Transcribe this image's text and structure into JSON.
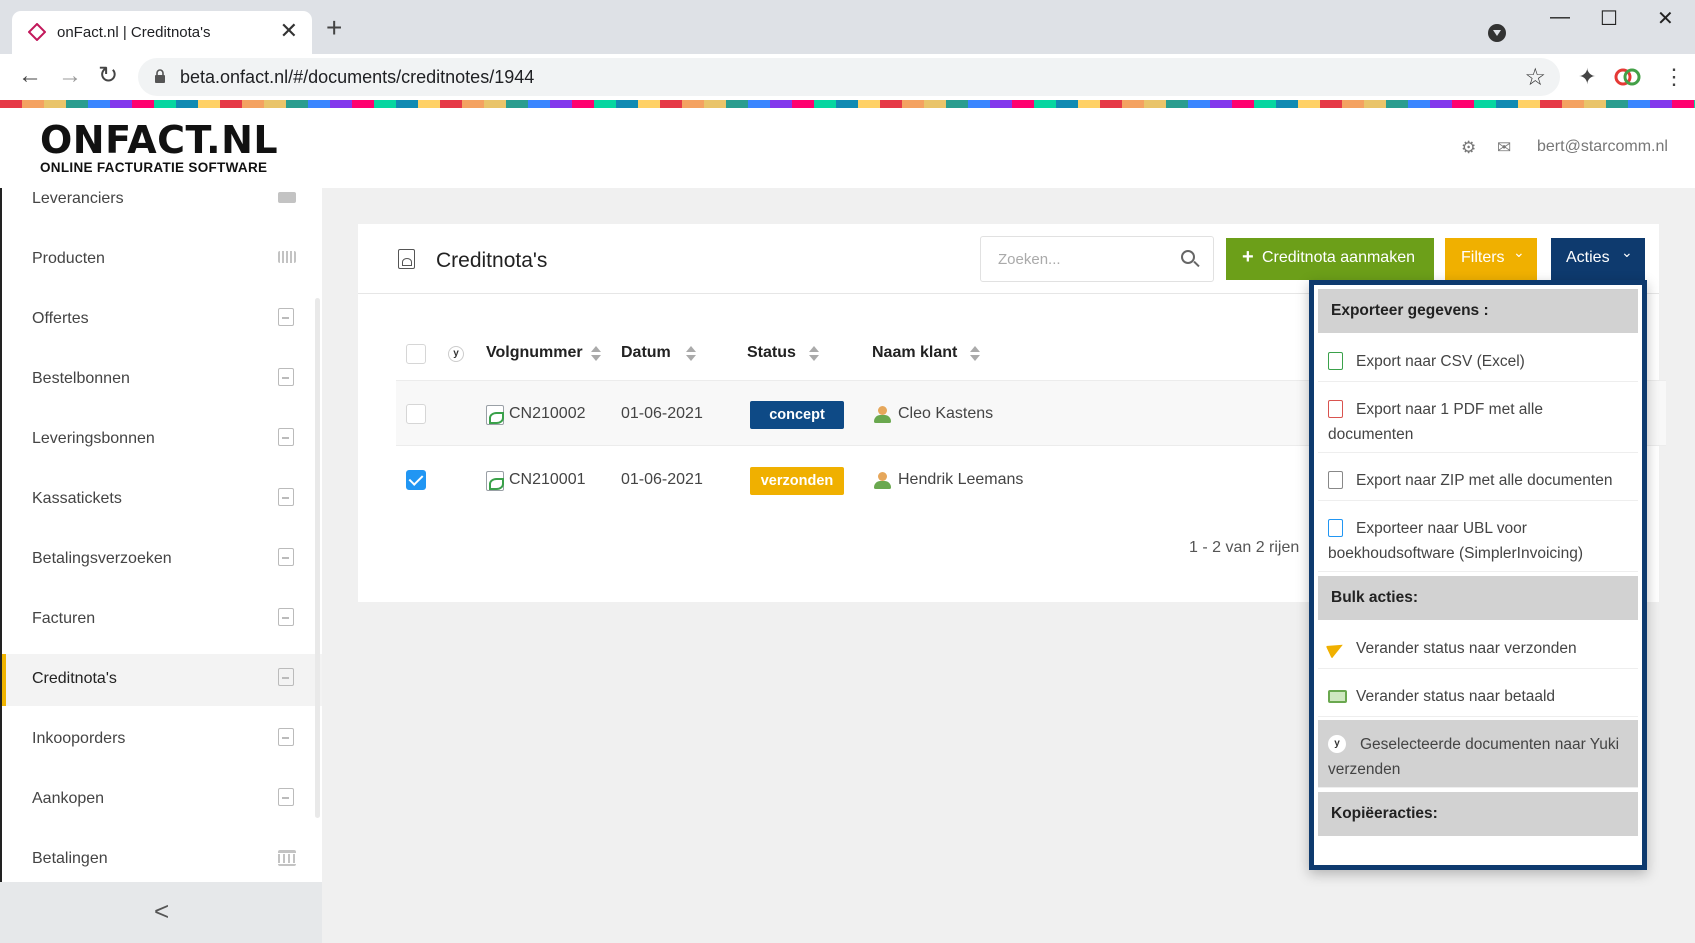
{
  "browser": {
    "tab_title": "onFact.nl | Creditnota's",
    "new_tab": "+",
    "url": "beta.onfact.nl/#/documents/creditnotes/1944",
    "close": "✕",
    "minimize": "—",
    "maximize": "☐",
    "window_close": "✕"
  },
  "header": {
    "logo_main": "ONFACT.NL",
    "logo_sub": "ONLINE FACTURATIE SOFTWARE",
    "user": "bert@starcomm.nl"
  },
  "sidebar": {
    "items": [
      {
        "label": "Leveranciers",
        "icon": "truck-icon"
      },
      {
        "label": "Producten",
        "icon": "barcode-icon"
      },
      {
        "label": "Offertes",
        "icon": "pdf-icon"
      },
      {
        "label": "Bestelbonnen",
        "icon": "pdf-icon"
      },
      {
        "label": "Leveringsbonnen",
        "icon": "pdf-icon"
      },
      {
        "label": "Kassatickets",
        "icon": "pdf-icon"
      },
      {
        "label": "Betalingsverzoeken",
        "icon": "pdf-icon"
      },
      {
        "label": "Facturen",
        "icon": "pdf-icon"
      },
      {
        "label": "Creditnota's",
        "icon": "pdf-icon",
        "active": true
      },
      {
        "label": "Inkooporders",
        "icon": "pdf-icon"
      },
      {
        "label": "Aankopen",
        "icon": "pdf-icon"
      },
      {
        "label": "Betalingen",
        "icon": "bank-icon"
      }
    ],
    "collapse": "<"
  },
  "main": {
    "title": "Creditnota's",
    "search_placeholder": "Zoeken...",
    "create_button": "Creditnota aanmaken",
    "create_icon": "+",
    "filters_button": "Filters",
    "acties_button": "Acties",
    "chevron": "⌄",
    "table": {
      "columns": [
        "Volgnummer",
        "Datum",
        "Status",
        "Naam klant"
      ],
      "yuki_column": "y",
      "rows": [
        {
          "number": "CN210002",
          "date": "01-06-2021",
          "status": "concept",
          "client": "Cleo Kastens",
          "checked": false
        },
        {
          "number": "CN210001",
          "date": "01-06-2021",
          "status": "verzonden",
          "client": "Hendrik Leemans",
          "checked": true
        }
      ]
    },
    "pagination": "1 - 2 van 2 rijen"
  },
  "acties_menu": {
    "export_header": "Exporteer gegevens :",
    "export_items": [
      {
        "label": "Export naar CSV (Excel)",
        "icon": "excel-icon"
      },
      {
        "label": "Export naar 1 PDF met alle documenten",
        "icon": "pdf-icon"
      },
      {
        "label": "Export naar ZIP met alle documenten",
        "icon": "zip-icon"
      },
      {
        "label": "Exporteer naar UBL voor boekhoudsoftware (SimplerInvoicing)",
        "icon": "code-file-icon"
      }
    ],
    "bulk_header": "Bulk acties:",
    "bulk_items": [
      {
        "label": "Verander status naar verzonden",
        "icon": "paper-plane-icon"
      },
      {
        "label": "Verander status naar betaald",
        "icon": "money-icon"
      },
      {
        "label": "Geselecteerde documenten naar Yuki verzenden",
        "icon": "yuki-icon"
      }
    ],
    "copy_header": "Kopiëeracties:"
  }
}
